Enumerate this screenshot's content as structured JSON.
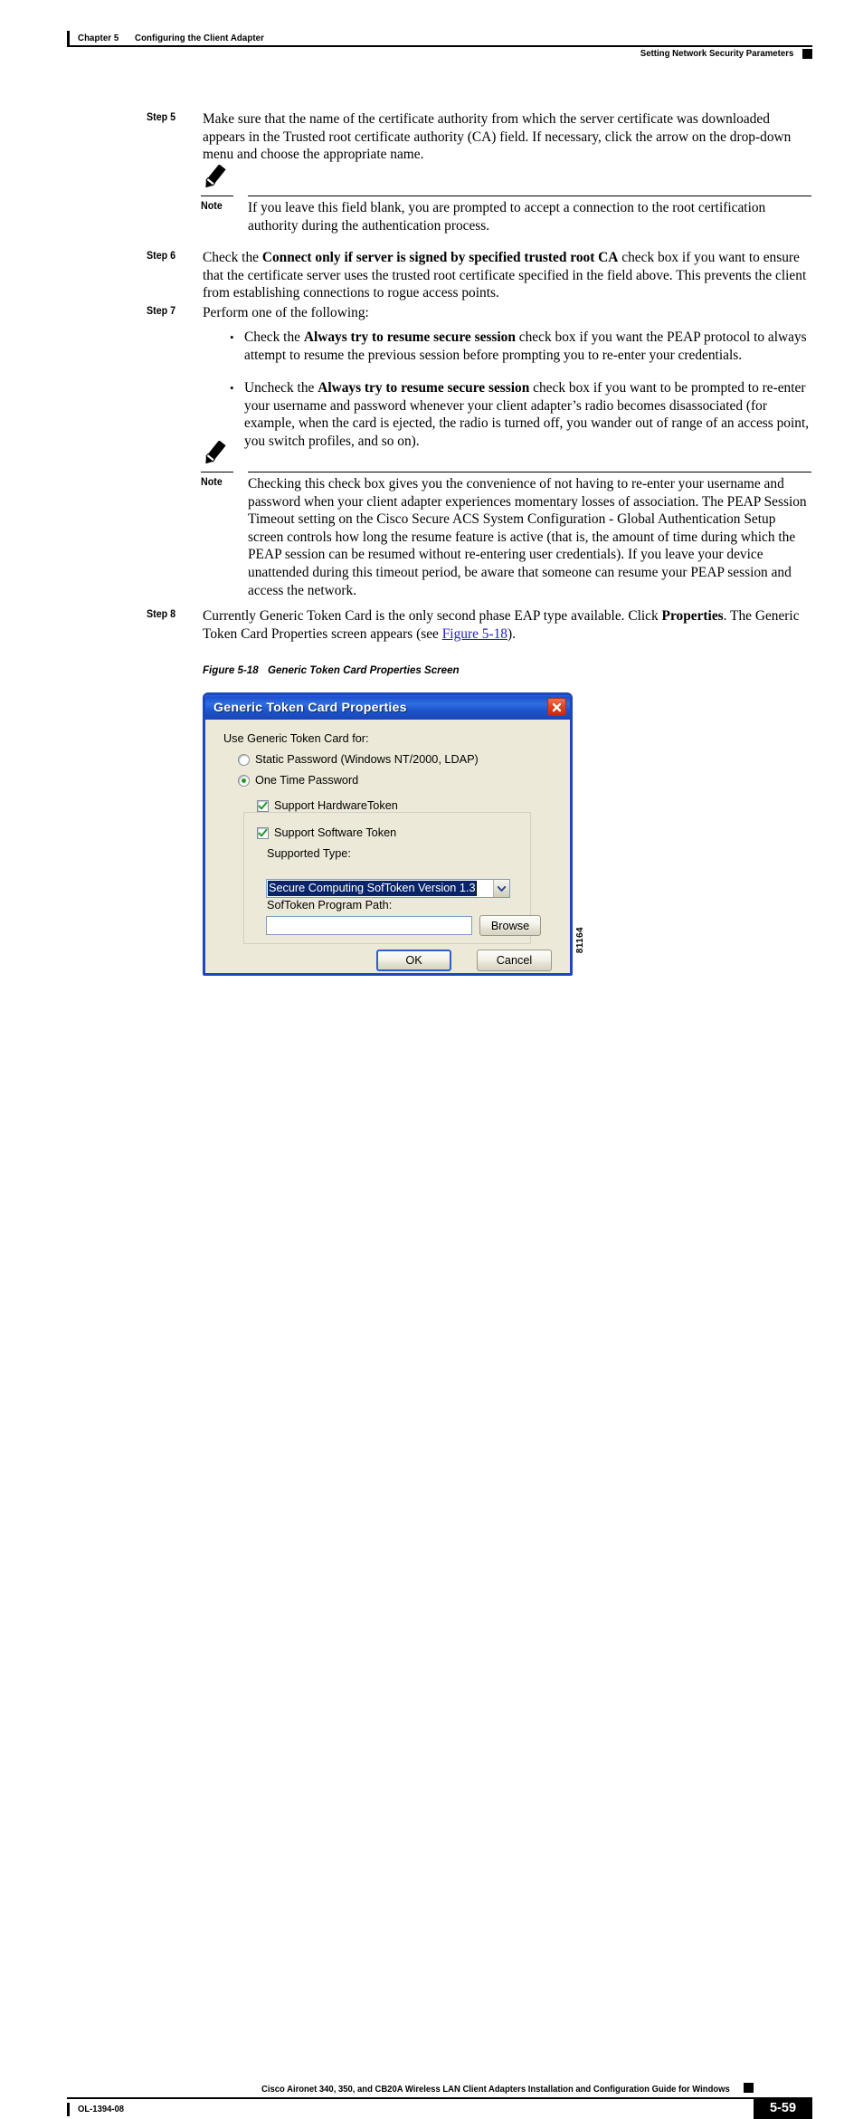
{
  "header": {
    "chapter_number": "Chapter 5",
    "chapter_title": "Configuring the Client Adapter",
    "section_title": "Setting Network Security Parameters"
  },
  "steps": {
    "step5": {
      "label": "Step 5",
      "text": "Make sure that the name of the certificate authority from which the server certificate was downloaded appears in the Trusted root certificate authority (CA) field. If necessary, click the arrow on the drop-down menu and choose the appropriate name."
    },
    "step6": {
      "label": "Step 6",
      "text_before": "Check the ",
      "bold": "Connect only if server is signed by specified trusted root CA",
      "text_after": " check box if you want to ensure that the certificate server uses the trusted root certificate specified in the field above. This prevents the client from establishing connections to rogue access points."
    },
    "step7": {
      "label": "Step 7",
      "text": "Perform one of the following:",
      "bullets": [
        {
          "marker": "•",
          "text_before": "Check the ",
          "bold": "Always try to resume secure session",
          "text_after": " check box if you want the PEAP protocol to always attempt to resume the previous session before prompting you to re-enter your credentials."
        },
        {
          "marker": "•",
          "text_before": "Uncheck the ",
          "bold": "Always try to resume secure session",
          "text_after": " check box if you want to be prompted to re-enter your username and password whenever your client adapter’s radio becomes disassociated (for example, when the card is ejected, the radio is turned off, you wander out of range of an access point, you switch profiles, and so on)."
        }
      ]
    },
    "step8": {
      "label": "Step 8",
      "text_before": "Currently Generic Token Card is the only second phase EAP type available. Click ",
      "bold": "Properties",
      "text_mid": ". The Generic Token Card Properties screen appears (see ",
      "xref": "Figure 5-18",
      "text_after": ")."
    }
  },
  "notes": {
    "note1": {
      "label": "Note",
      "icon": "pencil-icon",
      "text": "If you leave this field blank, you are prompted to accept a connection to the root certification authority during the authentication process."
    },
    "note2": {
      "label": "Note",
      "icon": "pencil-icon",
      "text": "Checking this check box gives you the convenience of not having to re-enter your username and password when your client adapter experiences momentary losses of association. The PEAP Session Timeout setting on the Cisco Secure ACS System Configuration - Global Authentication Setup screen controls how long the resume feature is active (that is, the amount of time during which the PEAP session can be resumed without re-entering user credentials). If you leave your device unattended during this timeout period, be aware that someone can resume your PEAP session and access the network."
    }
  },
  "figure": {
    "caption_number": "Figure 5-18",
    "caption_title": "Generic Token Card Properties Screen",
    "figure_id": "81164"
  },
  "dialog": {
    "title": "Generic Token Card Properties",
    "close_icon": "close-icon",
    "group_label": "Use Generic Token Card for:",
    "radios": [
      {
        "label": "Static Password (Windows NT/2000, LDAP)",
        "selected": false
      },
      {
        "label": "One Time Password",
        "selected": true
      }
    ],
    "checkboxes": [
      {
        "label": "Support HardwareToken",
        "checked": true
      },
      {
        "label": "Support Software Token",
        "checked": true
      }
    ],
    "supported_type_label": "Supported Type:",
    "supported_type_value": "Secure Computing SofToken Version 1.3",
    "dropdown_icon": "chevron-down-icon",
    "program_path_label": "SofToken Program Path:",
    "program_path_value": "",
    "program_path_placeholder": "",
    "browse_label": "Browse",
    "ok_label": "OK",
    "cancel_label": "Cancel",
    "colors": {
      "titlebar_blue": "#1d4fd0",
      "window_border": "#1c47bd",
      "client_bg": "#ece9d8",
      "close_red": "#e24723",
      "selection_blue": "#0a246a",
      "check_green": "#1f9b27"
    }
  },
  "footer": {
    "guide_title": "Cisco Aironet 340, 350, and CB20A Wireless LAN Client Adapters Installation and Configuration Guide for Windows",
    "doc_id": "OL-1394-08",
    "page_number": "5-59"
  }
}
